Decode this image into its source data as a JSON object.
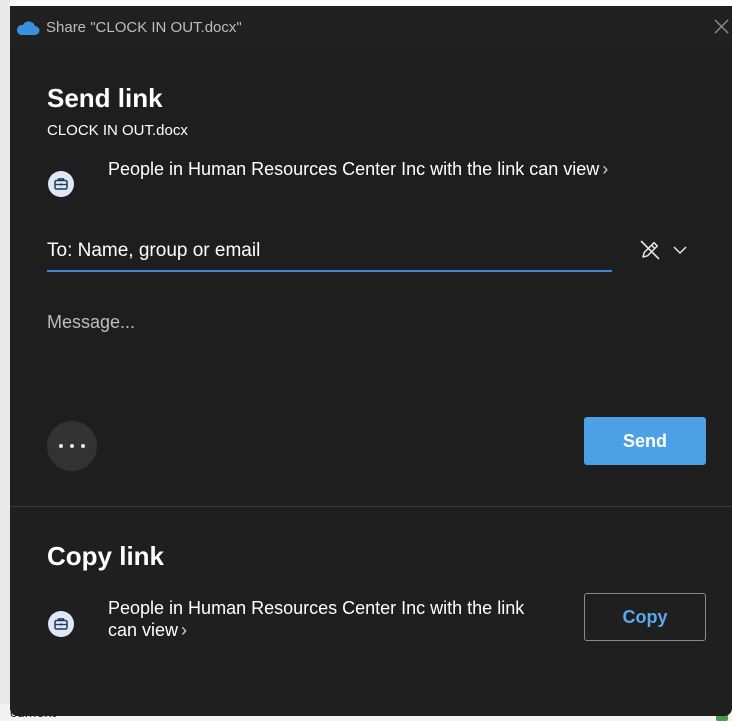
{
  "dialog": {
    "title": "Share \"CLOCK IN OUT.docx\""
  },
  "send_link": {
    "heading": "Send link",
    "filename": "CLOCK IN OUT.docx",
    "permission": "People in Human Resources Center Inc with the link can view",
    "chevron": "›",
    "to_placeholder": "To: Name, group or email",
    "to_value": "",
    "message_placeholder": "Message...",
    "message_value": "",
    "send_label": "Send"
  },
  "copy_link": {
    "heading": "Copy link",
    "permission": "People in Human Resources Center Inc with the link can view",
    "chevron": "›",
    "copy_label": "Copy"
  },
  "background": {
    "partial_text": "cument"
  },
  "colors": {
    "dialog_bg": "#202020",
    "accent": "#4ba0e6",
    "input_underline": "#3b86d6",
    "copy_text": "#5aa9ee"
  },
  "icons": {
    "title": "onedrive-cloud-icon",
    "close": "close-icon",
    "permission": "briefcase-icon",
    "edit_permission": "pencil-off-icon",
    "dropdown": "chevron-down-icon",
    "more": "more-options-icon"
  }
}
